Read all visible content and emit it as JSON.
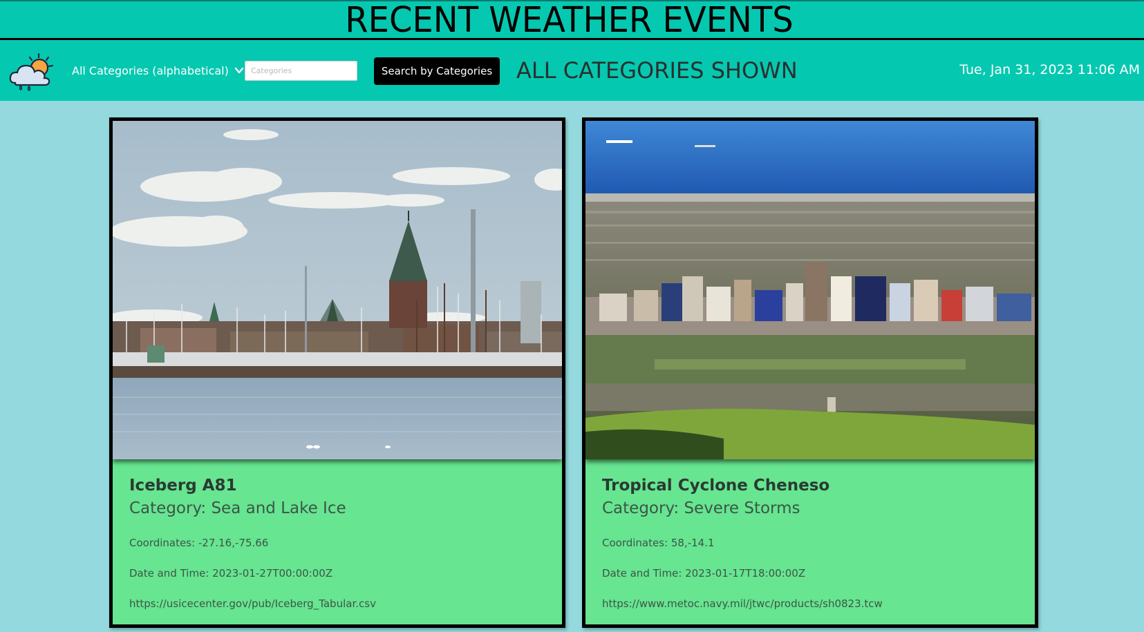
{
  "header": {
    "title": "RECENT WEATHER EVENTS"
  },
  "nav": {
    "logo_icon": "cloud-sun-rain-icon",
    "category_select": "All Categories (alphabetical)",
    "search_placeholder": "Categories",
    "search_button": "Search by Categories",
    "status": "ALL CATEGORIES SHOWN",
    "datetime": "Tue, Jan 31, 2023 11:06 AM"
  },
  "colors": {
    "accent": "#05c8b0",
    "page_bg": "#93d9dd",
    "card_bg": "#67e590",
    "button_bg": "#000000"
  },
  "events": [
    {
      "name": "Iceberg A81",
      "category": "Category: Sea and Lake Ice",
      "coordinates": "Coordinates: -27.16,-75.66",
      "datetime": "Date and Time: 2023-01-27T00:00:00Z",
      "source": "https://usicecenter.gov/pub/Iceberg_Tabular.csv",
      "image": "harbor-town-photo"
    },
    {
      "name": "Tropical Cyclone Cheneso",
      "category": "Category: Severe Storms",
      "coordinates": "Coordinates: 58,-14.1",
      "datetime": "Date and Time: 2023-01-17T18:00:00Z",
      "source": "https://www.metoc.navy.mil/jtwc/products/sh0823.tcw",
      "image": "coastal-city-photo"
    }
  ]
}
